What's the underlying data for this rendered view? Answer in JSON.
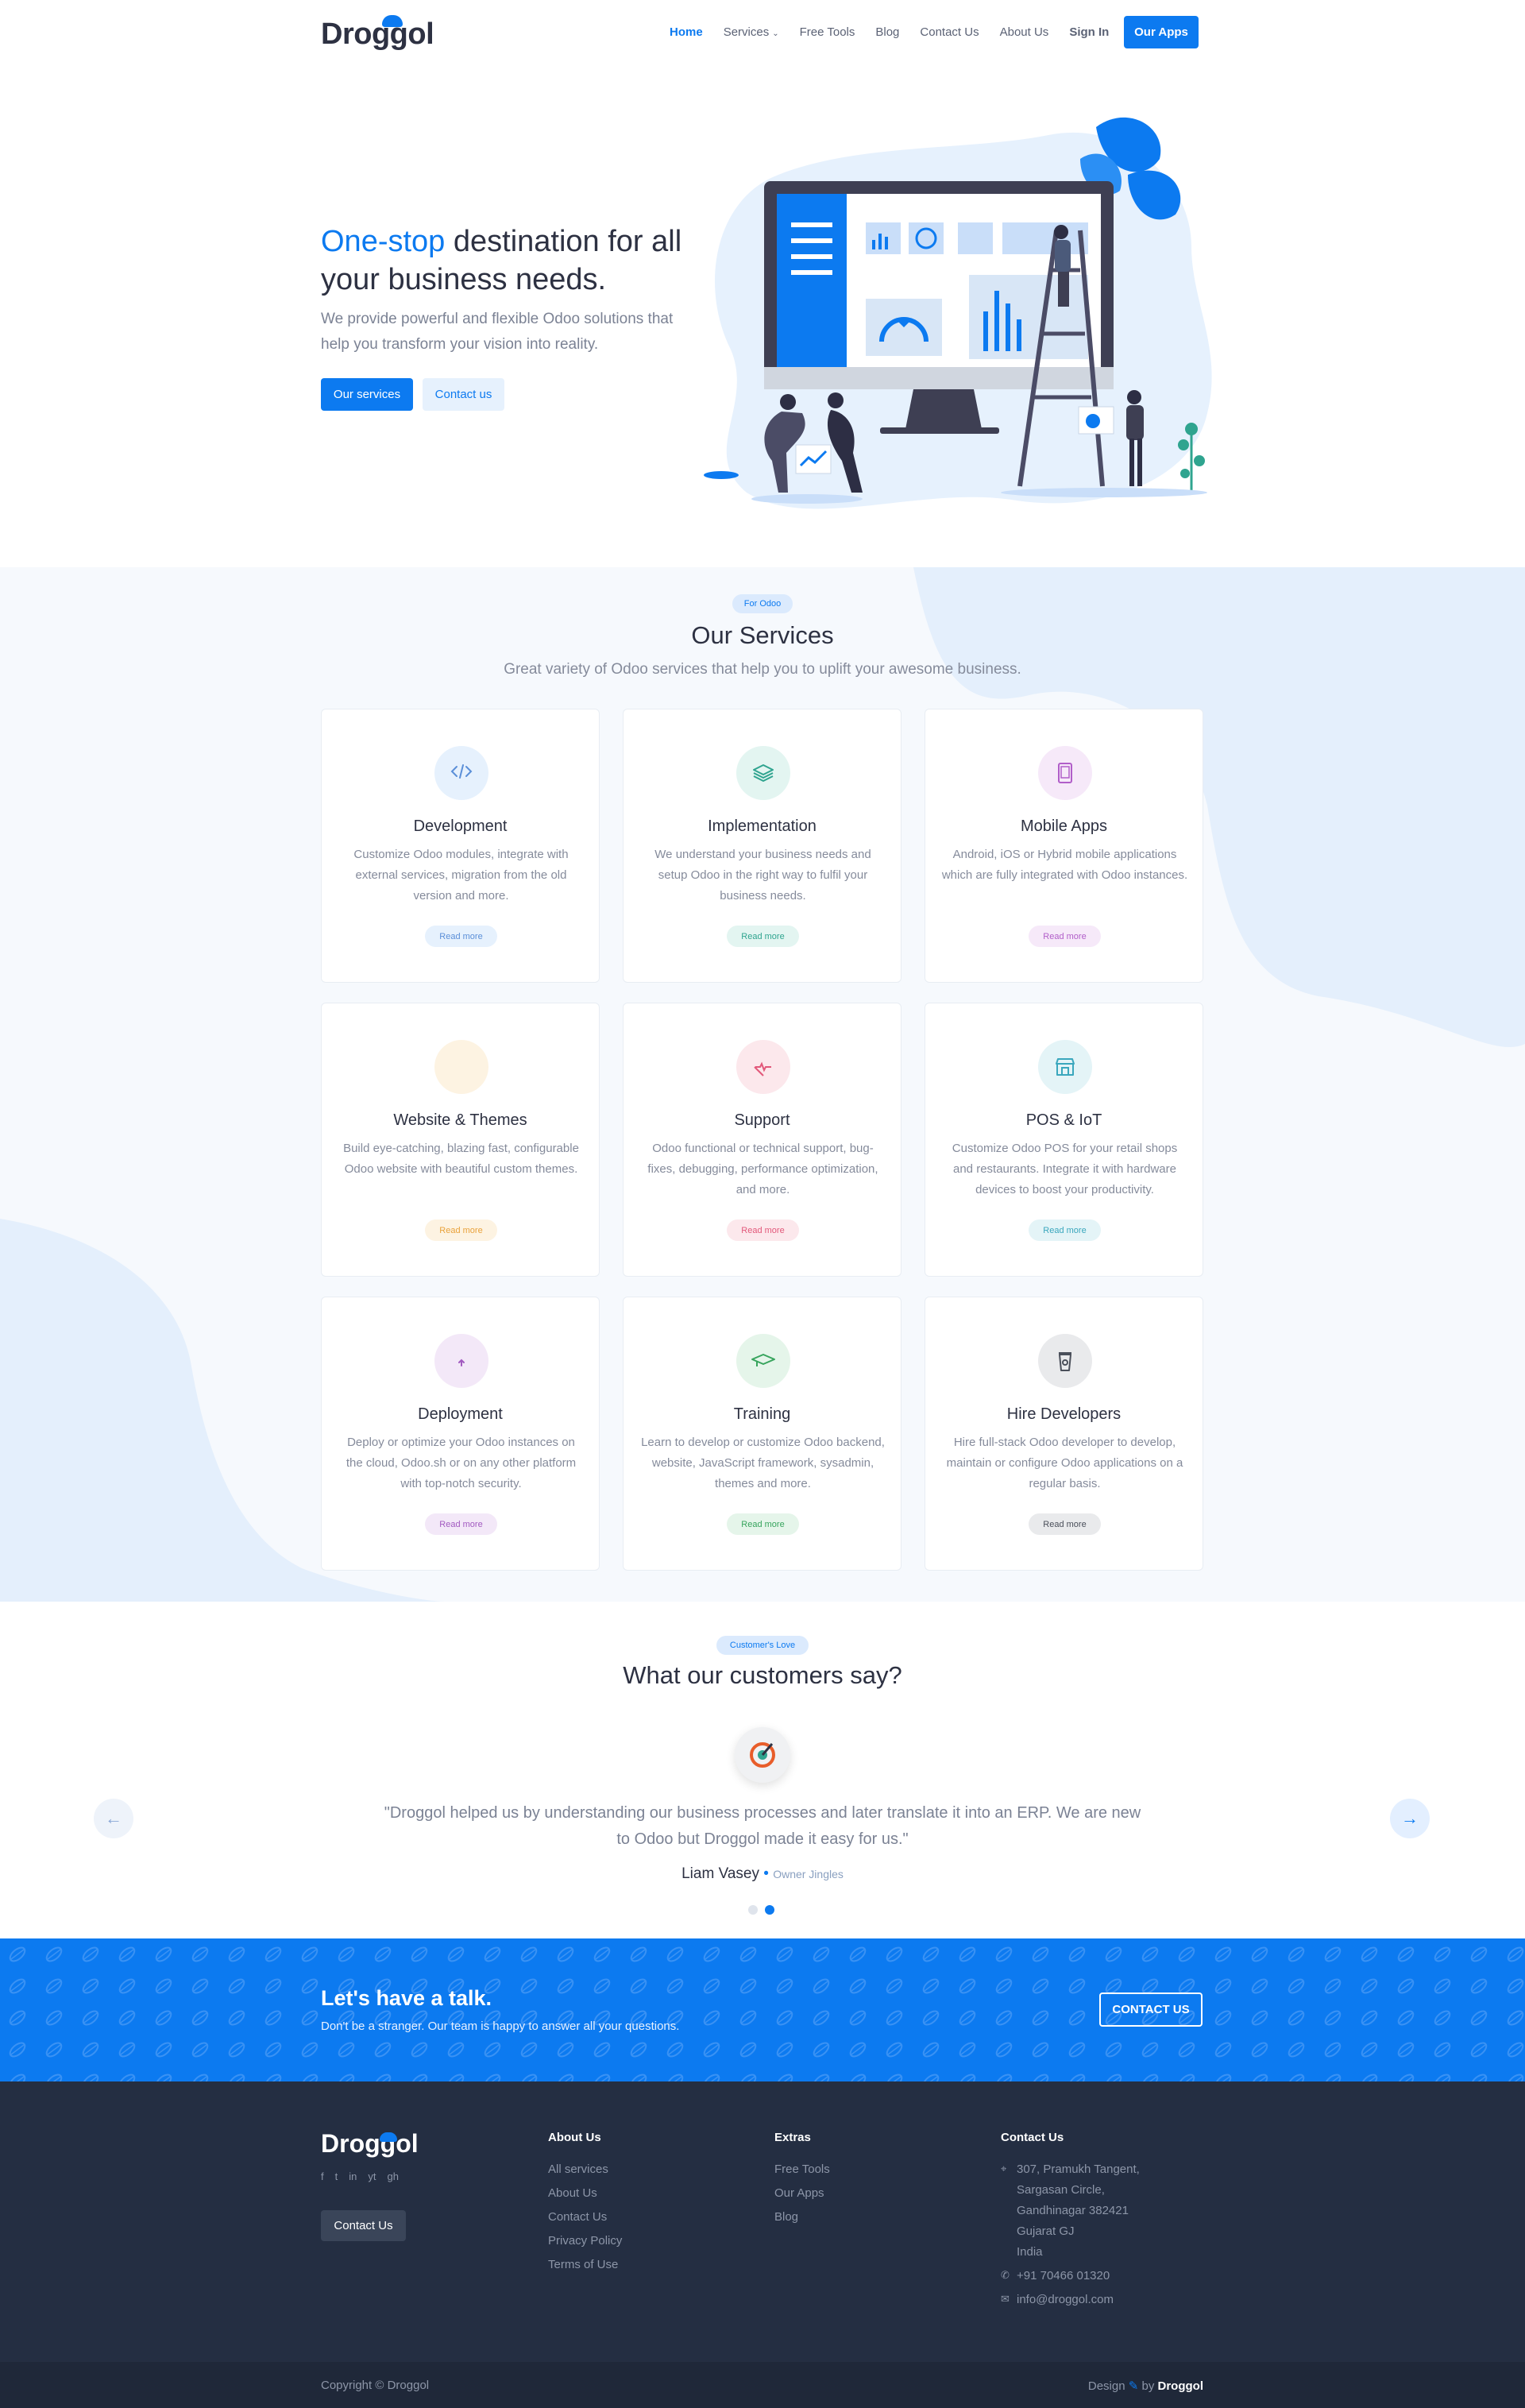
{
  "nav": {
    "logo": "Droggol",
    "items": [
      "Home",
      "Services",
      "Free Tools",
      "Blog",
      "Contact Us",
      "About Us",
      "Sign In"
    ],
    "apps_button": "Our Apps"
  },
  "hero": {
    "title_highlight": "One-stop",
    "title_rest": " destination for all your business needs.",
    "subtitle": "We provide powerful and flexible Odoo solutions that help you transform your vision into reality.",
    "primary_button": "Our services",
    "secondary_button": "Contact us"
  },
  "services": {
    "badge": "For Odoo",
    "title": "Our Services",
    "subtitle": "Great variety of Odoo services that help you to uplift your awesome business.",
    "cards": [
      {
        "title": "Development",
        "desc": "Customize Odoo modules, integrate with external services, migration from the old version and more.",
        "more": "Read more",
        "icon": "code-icon",
        "color": "#5b8fd8",
        "bg": "#e6f1fd"
      },
      {
        "title": "Implementation",
        "desc": "We understand your business needs and setup Odoo  in the right way to fulfil your business needs.",
        "more": "Read more",
        "icon": "layers-icon",
        "color": "#2fa48f",
        "bg": "#e3f5f1"
      },
      {
        "title": "Mobile Apps",
        "desc": "Android, iOS or Hybrid mobile applications which are fully integrated with Odoo instances.",
        "more": "Read more",
        "icon": "tablet-icon",
        "color": "#b15ec9",
        "bg": "#f6e9f9"
      },
      {
        "title": "Website & Themes",
        "desc": "Build eye-catching, blazing fast, configurable Odoo website with beautiful custom themes.",
        "more": "Read more",
        "icon": "brush-icon",
        "color": "#e9a23b",
        "bg": "#fdf3e2"
      },
      {
        "title": "Support",
        "desc": "Odoo functional or technical support, bug-fixes, debugging, performance optimization, and more.",
        "more": "Read more",
        "icon": "heartbeat-icon",
        "color": "#e2587a",
        "bg": "#fce8ec"
      },
      {
        "title": "POS & IoT",
        "desc": "Customize Odoo POS for your retail shops and restaurants. Integrate it with hardware devices to boost your productivity.",
        "more": "Read more",
        "icon": "store-icon",
        "color": "#3aa7bd",
        "bg": "#e4f4f7"
      },
      {
        "title": "Deployment",
        "desc": "Deploy or optimize your Odoo instances on the cloud, Odoo.sh or on any other platform with top-notch security.",
        "more": "Read more",
        "icon": "cloud-upload-icon",
        "color": "#a25ac0",
        "bg": "#f3e8f8"
      },
      {
        "title": "Training",
        "desc": "Learn to develop or customize Odoo backend, website, JavaScript framework, sysadmin, themes and more.",
        "more": "Read more",
        "icon": "graduation-cap-icon",
        "color": "#37a45d",
        "bg": "#e5f5ea"
      },
      {
        "title": "Hire Developers",
        "desc": "Hire full-stack Odoo developer to develop, maintain or configure Odoo applications on a regular basis.",
        "more": "Read more",
        "icon": "coffee-cup-icon",
        "color": "#4a4f5a",
        "bg": "#e9eaec"
      }
    ]
  },
  "testimonials": {
    "badge": "Customer's Love",
    "title": "What our customers say?",
    "quote": "\"Droggol helped us by understanding our business processes and later translate it into an ERP. We are new to Odoo but Droggol made it easy for us.\"",
    "author": "Liam Vasey",
    "role": "Owner Jingles",
    "prev": "←",
    "next": "→"
  },
  "cta": {
    "title": "Let's have a talk.",
    "subtitle": "Don't be a stranger. Our team is happy to answer all your questions.",
    "button": "CONTACT US"
  },
  "footer": {
    "logo": "Droggol",
    "contact_button": "Contact Us",
    "social": [
      "f",
      "t",
      "in",
      "yt",
      "gh"
    ],
    "about_title": "About Us",
    "about_links": [
      "All services",
      "About Us",
      "Contact Us",
      "Privacy Policy",
      "Terms of Use"
    ],
    "extras_title": "Extras",
    "extras_links": [
      "Free Tools",
      "Our Apps",
      "Blog"
    ],
    "contact_title": "Contact Us",
    "address": [
      "307, Pramukh Tangent,",
      "Sargasan Circle,",
      "Gandhinagar 382421",
      "Gujarat GJ",
      "India"
    ],
    "phone": "+91 70466 01320",
    "email": "info@droggol.com",
    "copyright": "Copyright © Droggol",
    "design_by_prefix": "Design",
    "design_by_mid": " by ",
    "design_by_brand": "Droggol"
  }
}
